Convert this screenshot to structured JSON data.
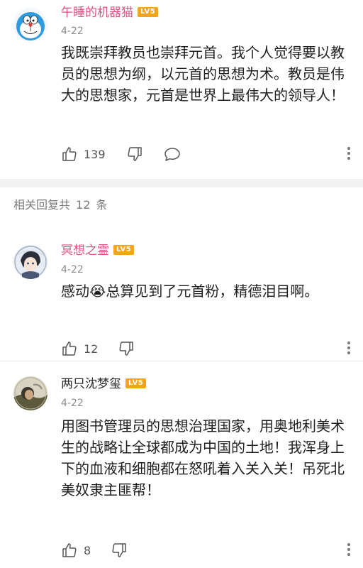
{
  "comments": [
    {
      "username": "午睡的机器猫",
      "level": "LV5",
      "date": "4-22",
      "text": "我既崇拜教员也崇拜元首。我个人觉得要以教员的思想为纲，以元首的思想为术。教员是伟大的思想家，元首是世界上最伟大的领导人！",
      "likes": "139",
      "avatar_icon": "doraemon-avatar"
    },
    {
      "username": "冥想之霊",
      "level": "LV5",
      "date": "4-22",
      "text": "感动😭总算见到了元首粉，精德泪目啊。",
      "likes": "12",
      "avatar_icon": "anime-avatar"
    },
    {
      "username": "两只沈梦玺",
      "level": "LV5",
      "date": "4-22",
      "text": "用图书管理员的思想治理国家，用奥地利美术生的战略让全球都成为中国的土地！我浑身上下的血液和细胞都在怒吼着入关入关！吊死北美奴隶主匪帮！",
      "likes": "8",
      "avatar_icon": "photo-avatar"
    }
  ],
  "replies_header": {
    "label": "相关回复共",
    "count": "12",
    "unit": "条"
  },
  "colors": {
    "vip_name": "#e0527f",
    "level_badge": "#f3a417",
    "secondary_text": "#8c8c8c",
    "divider": "#f2f2f2"
  }
}
